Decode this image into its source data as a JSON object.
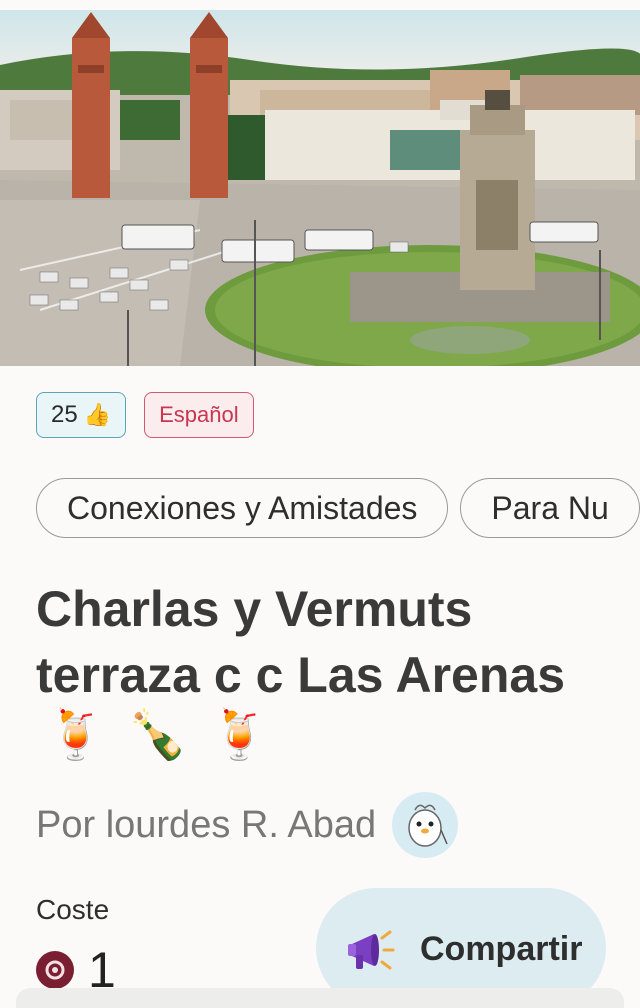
{
  "likes": {
    "count": "25",
    "icon": "thumbs-up-icon"
  },
  "language": "Español",
  "categories": [
    "Conexiones y Amistades",
    "Para Nu"
  ],
  "title": "Charlas y Vermuts terraza c c Las Arenas",
  "title_emojis": [
    "🍹",
    "🍾",
    "🍹"
  ],
  "author": {
    "text": "Por lourdes R. Abad"
  },
  "cost": {
    "label": "Coste",
    "value": "1"
  },
  "share": {
    "label": "Compartir",
    "icon": "megaphone-icon"
  },
  "colors": {
    "background": "#fbfaf8",
    "likes_border": "#5aa5b8",
    "lang_border": "#d05a6e",
    "lang_text": "#c8364f",
    "share_bg": "#dcecf1",
    "coin": "#7a1f31"
  }
}
